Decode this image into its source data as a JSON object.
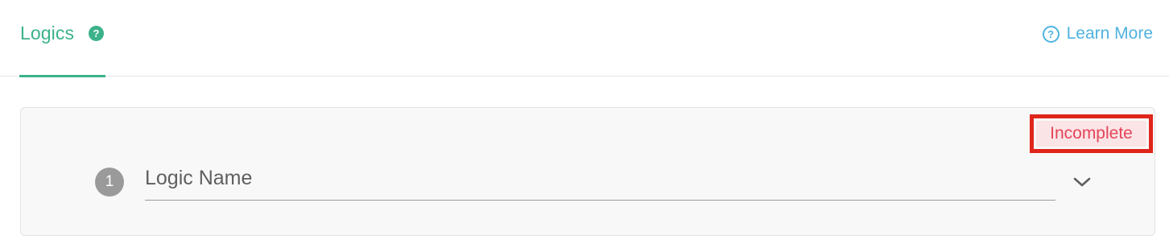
{
  "header": {
    "tab_label": "Logics",
    "help_glyph": "?",
    "learn_more_label": "Learn More",
    "learn_more_glyph": "?"
  },
  "card": {
    "status": "Incomplete",
    "step_number": "1",
    "logic_name": {
      "value": "",
      "placeholder": "Logic Name"
    }
  },
  "icons": {
    "help": "question-circle-icon",
    "learn_more": "question-circle-outline-icon",
    "expand": "chevron-down-icon"
  },
  "colors": {
    "accent_green": "#3bb28a",
    "link_blue": "#4fb3e0",
    "status_text": "#e3455a",
    "status_bg": "#fbe4e6",
    "highlight_red": "#e0251b",
    "step_gray": "#9a9a9a"
  }
}
